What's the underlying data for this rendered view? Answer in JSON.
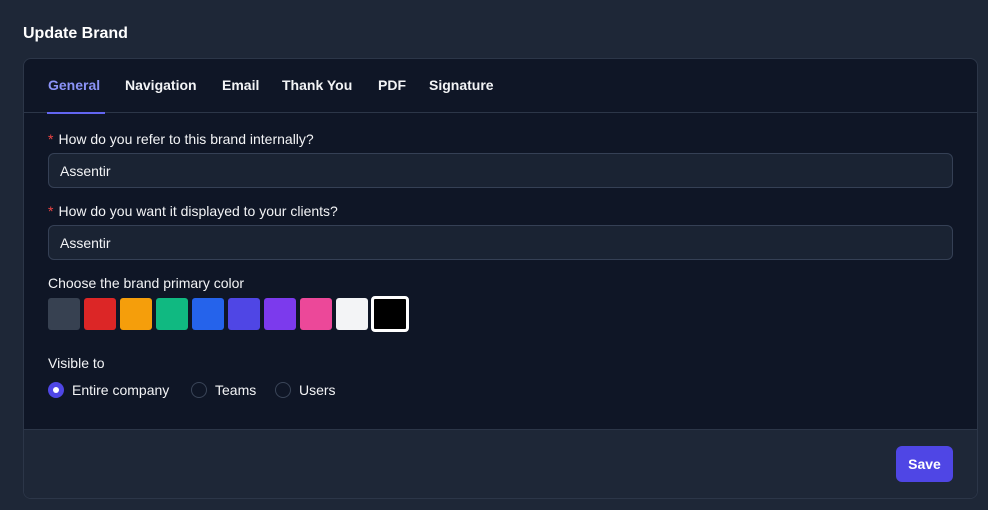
{
  "page": {
    "title": "Update Brand"
  },
  "tabs": [
    {
      "label": "General",
      "active": true
    },
    {
      "label": "Navigation",
      "active": false
    },
    {
      "label": "Email",
      "active": false
    },
    {
      "label": "Thank You",
      "active": false
    },
    {
      "label": "PDF",
      "active": false
    },
    {
      "label": "Signature",
      "active": false
    }
  ],
  "form": {
    "required_marker": "*",
    "internal_name": {
      "label": "How do you refer to this brand internally?",
      "value": "Assentir"
    },
    "display_name": {
      "label": "How do you want it displayed to your clients?",
      "value": "Assentir"
    },
    "color": {
      "label": "Choose the brand primary color",
      "swatches": [
        "#374151",
        "#dc2626",
        "#f59e0b",
        "#10b981",
        "#2563eb",
        "#4f46e5",
        "#7c3aed",
        "#ec4899",
        "#f3f4f6",
        "#000000"
      ],
      "selected": "#000000"
    },
    "visibility": {
      "label": "Visible to",
      "options": [
        {
          "label": "Entire company",
          "checked": true
        },
        {
          "label": "Teams",
          "checked": false
        },
        {
          "label": "Users",
          "checked": false
        }
      ]
    }
  },
  "footer": {
    "save_label": "Save"
  }
}
